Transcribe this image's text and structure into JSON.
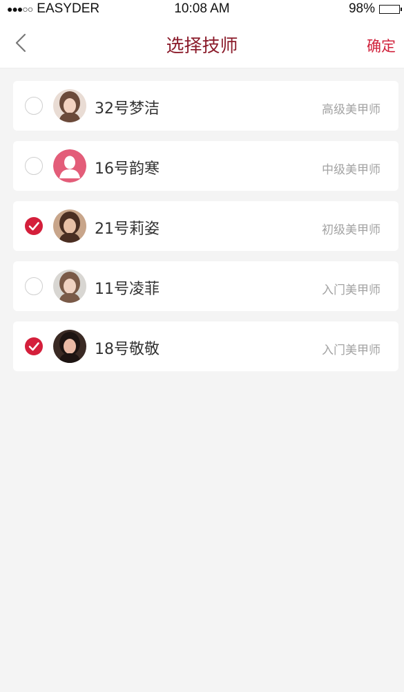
{
  "status_bar": {
    "carrier": "EASYDER",
    "time": "10:08 AM",
    "battery_text": "98%",
    "battery_level": 0.98
  },
  "header": {
    "title": "选择技师",
    "confirm_label": "确定",
    "back_icon": "chevron-left-icon"
  },
  "colors": {
    "accent": "#d41f3b",
    "title": "#8b1c2b",
    "background": "#f4f4f4"
  },
  "technicians": [
    {
      "name": "32号梦洁",
      "level": "高级美甲师",
      "selected": false,
      "avatar": "photo"
    },
    {
      "name": "16号韵寒",
      "level": "中级美甲师",
      "selected": false,
      "avatar": "default-user"
    },
    {
      "name": "21号莉姿",
      "level": "初级美甲师",
      "selected": true,
      "avatar": "photo"
    },
    {
      "name": "11号凌菲",
      "level": "入门美甲师",
      "selected": false,
      "avatar": "photo"
    },
    {
      "name": "18号敬敬",
      "level": "入门美甲师",
      "selected": true,
      "avatar": "photo"
    }
  ]
}
